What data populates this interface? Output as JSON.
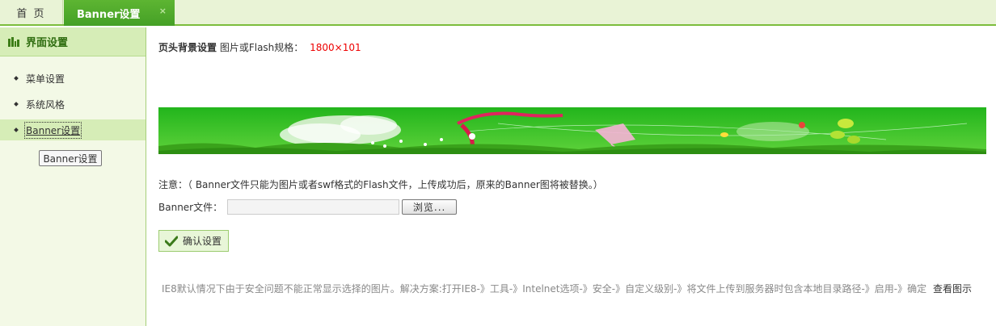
{
  "tabs": {
    "home": "首 页",
    "active": "Banner设置",
    "close": "×"
  },
  "sidebar": {
    "header": "界面设置",
    "items": [
      {
        "label": "菜单设置"
      },
      {
        "label": "系统风格"
      },
      {
        "label": "Banner设置"
      }
    ],
    "tooltip": "Banner设置"
  },
  "main": {
    "title_bold": "页头背景设置",
    "title_text": "图片或Flash规格：",
    "title_spec": "1800×101",
    "notice": "注意：（ Banner文件只能为图片或者swf格式的Flash文件，上传成功后，原来的Banner图将被替换。）",
    "file_label": "Banner文件：",
    "file_value": "",
    "browse_label": "浏览...",
    "confirm_label": "确认设置",
    "footer_note": "IE8默认情况下由于安全问题不能正常显示选择的图片。解决方案:打开IE8-》工具-》Intelnet选项-》安全-》自定义级别-》将文件上传到服务器时包含本地目录路径-》启用-》确定",
    "footer_link": "查看图示"
  },
  "colors": {
    "accent": "#5db532",
    "spec_red": "#e00000",
    "sidebar_bg": "#f3f9e6"
  }
}
